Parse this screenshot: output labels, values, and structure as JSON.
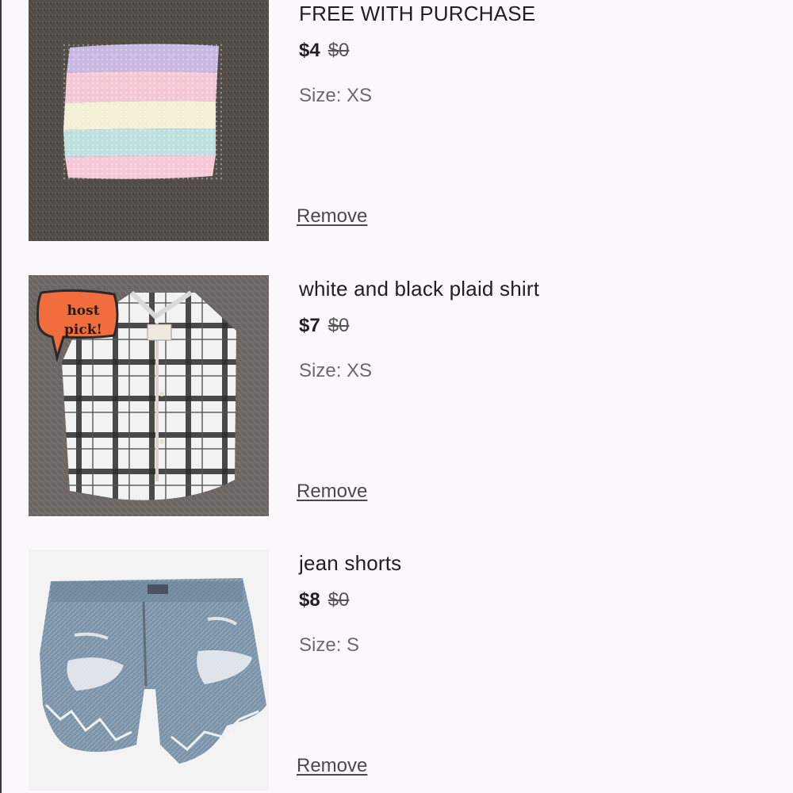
{
  "cart": {
    "items": [
      {
        "title": "FREE WITH PURCHASE",
        "price": "$4",
        "original_price": "$0",
        "size_label": "Size:",
        "size": "XS",
        "remove_label": "Remove",
        "image": "pastel-striped-tube-top"
      },
      {
        "title": "white and black plaid shirt",
        "price": "$7",
        "original_price": "$0",
        "size_label": "Size:",
        "size": "XS",
        "remove_label": "Remove",
        "image": "plaid-shirt",
        "sticker": [
          "host",
          "pick!"
        ]
      },
      {
        "title": "jean shorts",
        "price": "$8",
        "original_price": "$0",
        "size_label": "Size:",
        "size": "S",
        "remove_label": "Remove",
        "image": "distressed-jean-shorts"
      }
    ]
  },
  "colors": {
    "background": "#faf8fa",
    "text": "#1f1f1f",
    "muted": "#6a6a6a",
    "sticker": "#f26d3d"
  }
}
